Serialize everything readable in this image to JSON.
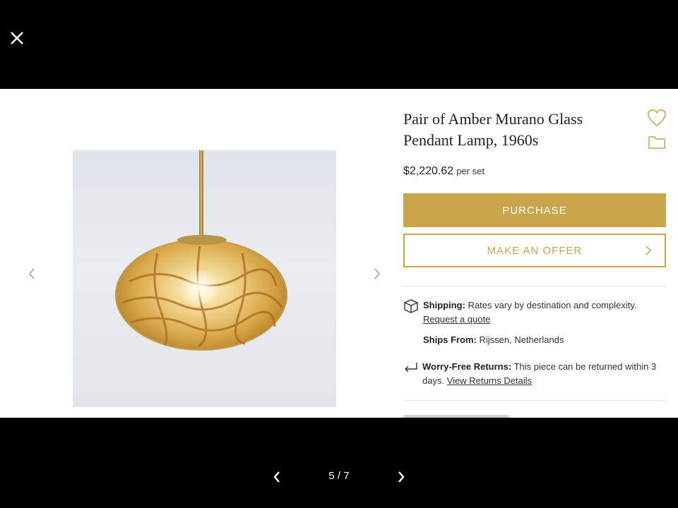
{
  "viewer": {
    "close_icon": "close-icon",
    "pager": {
      "label": "5 / 7",
      "prev_icon": "chevron-left-icon",
      "next_icon": "chevron-right-icon"
    }
  },
  "listing": {
    "title_line1": "Pair of Amber Murano Glass",
    "title_line2": "Pendant Lamp, 1960s",
    "price": "$2,220.62",
    "price_unit": "per set",
    "purchase_label": "PURCHASE",
    "offer_label": "MAKE AN OFFER",
    "favorite_icon": "heart-icon",
    "folder_icon": "folder-icon"
  },
  "details": {
    "shipping_label": "Shipping:",
    "shipping_text": "Rates vary by destination and complexity.",
    "shipping_link": "Request a quote",
    "ships_from_label": "Ships From:",
    "ships_from_value": "Rijssen, Netherlands",
    "returns_label": "Worry-Free Returns:",
    "returns_text_1": "This piece can be returned within 3",
    "returns_text_2": "days.",
    "returns_link": "View Returns Details"
  },
  "colors": {
    "accent": "#c9a54c",
    "background": "#000000",
    "panel": "#ffffff"
  }
}
